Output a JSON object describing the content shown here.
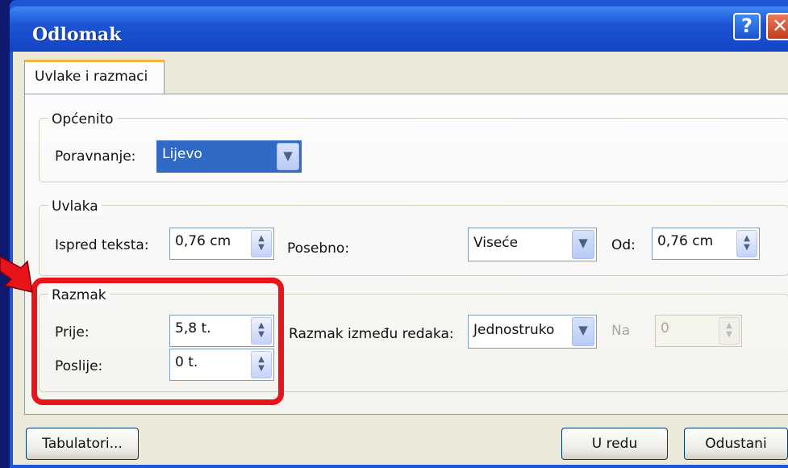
{
  "window": {
    "title": "Odlomak",
    "help_label": "?",
    "close_label": "✕",
    "colors": {
      "titlebar": "#1c54d4",
      "highlight": "#e8141a",
      "dialog_bg": "#ece9d8"
    }
  },
  "tabs": [
    {
      "label": "Uvlake i razmaci",
      "active": true
    }
  ],
  "general": {
    "legend": "Općenito",
    "alignment_label": "Poravnanje:",
    "alignment_value": "Lijevo"
  },
  "indent": {
    "legend": "Uvlaka",
    "before_label": "Ispred teksta:",
    "before_value": "0,76 cm",
    "special_label": "Posebno:",
    "special_value": "Viseće",
    "by_label": "Od:",
    "by_value": "0,76 cm"
  },
  "spacing": {
    "legend": "Razmak",
    "before_label": "Prije:",
    "before_value": "5,8 t.",
    "after_label": "Poslije:",
    "after_value": "0 t.",
    "line_spacing_label": "Razmak između redaka:",
    "line_spacing_value": "Jednostruko",
    "at_label": "Na",
    "at_value": "0"
  },
  "footer": {
    "tabs_button": "Tabulatori...",
    "ok_button": "U redu",
    "cancel_button": "Odustani"
  },
  "icons": [
    "help-icon",
    "close-icon",
    "spin-up-down-icon",
    "dropdown-chevron-icon",
    "red-arrow-icon"
  ]
}
